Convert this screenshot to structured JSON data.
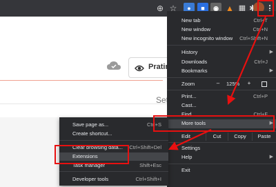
{
  "toolbar": {
    "icons": [
      "zoom-icon",
      "star-icon",
      "extension-icon",
      "extension-icon",
      "extension-icon",
      "metamask-icon",
      "extension-icon",
      "puzzle-icon",
      "profile-avatar",
      "menu-kebab-icon"
    ]
  },
  "page": {
    "pratin_label": "Pratin",
    "set_label": "Set"
  },
  "menu": {
    "new_tab": {
      "label": "New tab",
      "shortcut": "Ctrl+T"
    },
    "new_window": {
      "label": "New window",
      "shortcut": "Ctrl+N"
    },
    "new_incognito": {
      "label": "New incognito window",
      "shortcut": "Ctrl+Shift+N"
    },
    "history": {
      "label": "History"
    },
    "downloads": {
      "label": "Downloads",
      "shortcut": "Ctrl+J"
    },
    "bookmarks": {
      "label": "Bookmarks"
    },
    "zoom": {
      "label": "Zoom",
      "minus": "–",
      "value": "125%",
      "plus": "+"
    },
    "print": {
      "label": "Print...",
      "shortcut": "Ctrl+P"
    },
    "cast": {
      "label": "Cast..."
    },
    "find": {
      "label": "Find...",
      "shortcut": "Ctrl+F"
    },
    "more_tools": {
      "label": "More tools"
    },
    "edit": {
      "label": "Edit",
      "cut": "Cut",
      "copy": "Copy",
      "paste": "Paste"
    },
    "settings": {
      "label": "Settings"
    },
    "help": {
      "label": "Help"
    },
    "exit": {
      "label": "Exit"
    }
  },
  "submenu": {
    "save_page": {
      "label": "Save page as...",
      "shortcut": "Ctrl+S"
    },
    "create_shortcut": {
      "label": "Create shortcut..."
    },
    "clear_browsing": {
      "label": "Clear browsing data...",
      "shortcut": "Ctrl+Shift+Del"
    },
    "extensions": {
      "label": "Extensions"
    },
    "task_manager": {
      "label": "Task manager",
      "shortcut": "Shift+Esc"
    },
    "developer_tools": {
      "label": "Developer tools",
      "shortcut": "Ctrl+Shift+I"
    }
  },
  "colors": {
    "menu_bg": "#292a2d",
    "highlight": "#44464a",
    "annotation_red": "#e81010"
  }
}
